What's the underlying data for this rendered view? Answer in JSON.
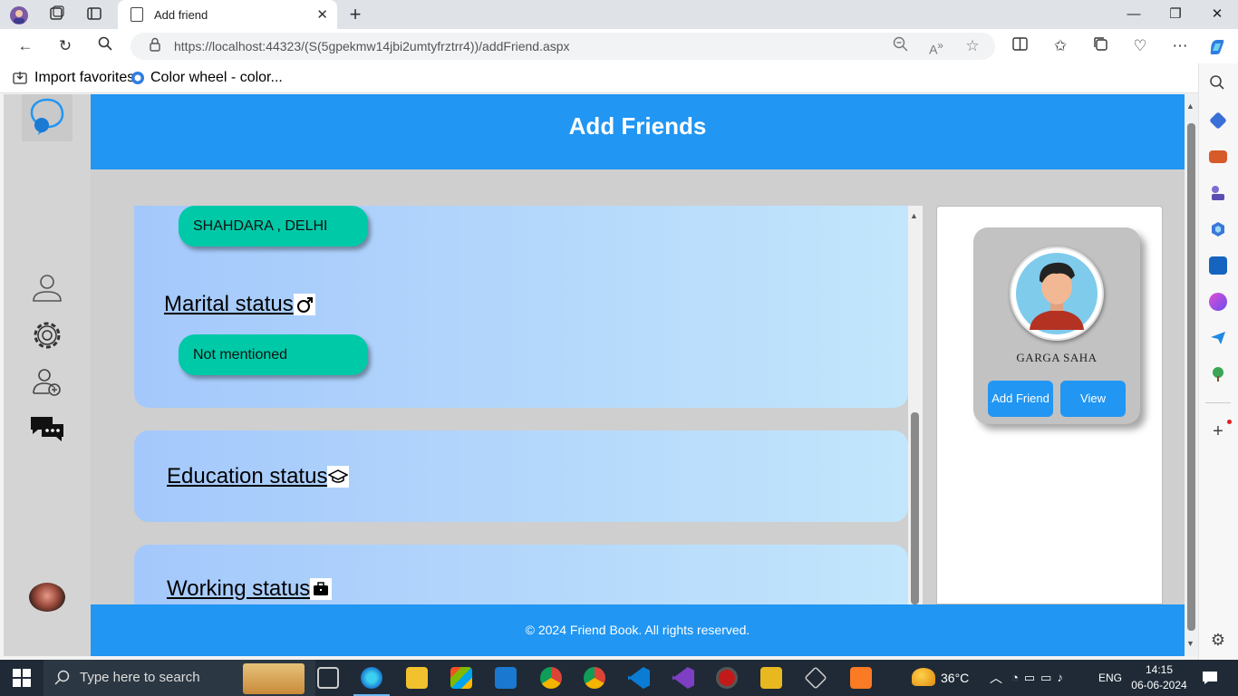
{
  "browser": {
    "tab_title": "Add friend",
    "url_host": "https://localhost",
    "url_rest": ":44323/(S(5gpekmw14jbi2umtyfrztrr4))/addFriend.aspx",
    "favorites": [
      "Import favorites",
      "Color wheel - color..."
    ]
  },
  "page": {
    "header_title": "Add Friends",
    "footer_text": "© 2024 Friend Book. All rights reserved.",
    "location_value": "SHAHDARA , DELHI",
    "marital_label": "Marital status ",
    "marital_value": "Not mentioned",
    "education_label": "Education status ",
    "working_label": "Working status "
  },
  "profile": {
    "name": "GARGA  SAHA",
    "add_button": "Add Friend",
    "view_button": "View"
  },
  "taskbar": {
    "search_placeholder": "Type here to search",
    "weather": "36°C",
    "language": "ENG",
    "time": "14:15",
    "date": "06-06-2024"
  },
  "colors": {
    "header_blue": "#2196f3",
    "pill_teal": "#00c9a7",
    "card_gradient_start": "#a4c8fb",
    "card_gradient_end": "#c2e6fb"
  }
}
